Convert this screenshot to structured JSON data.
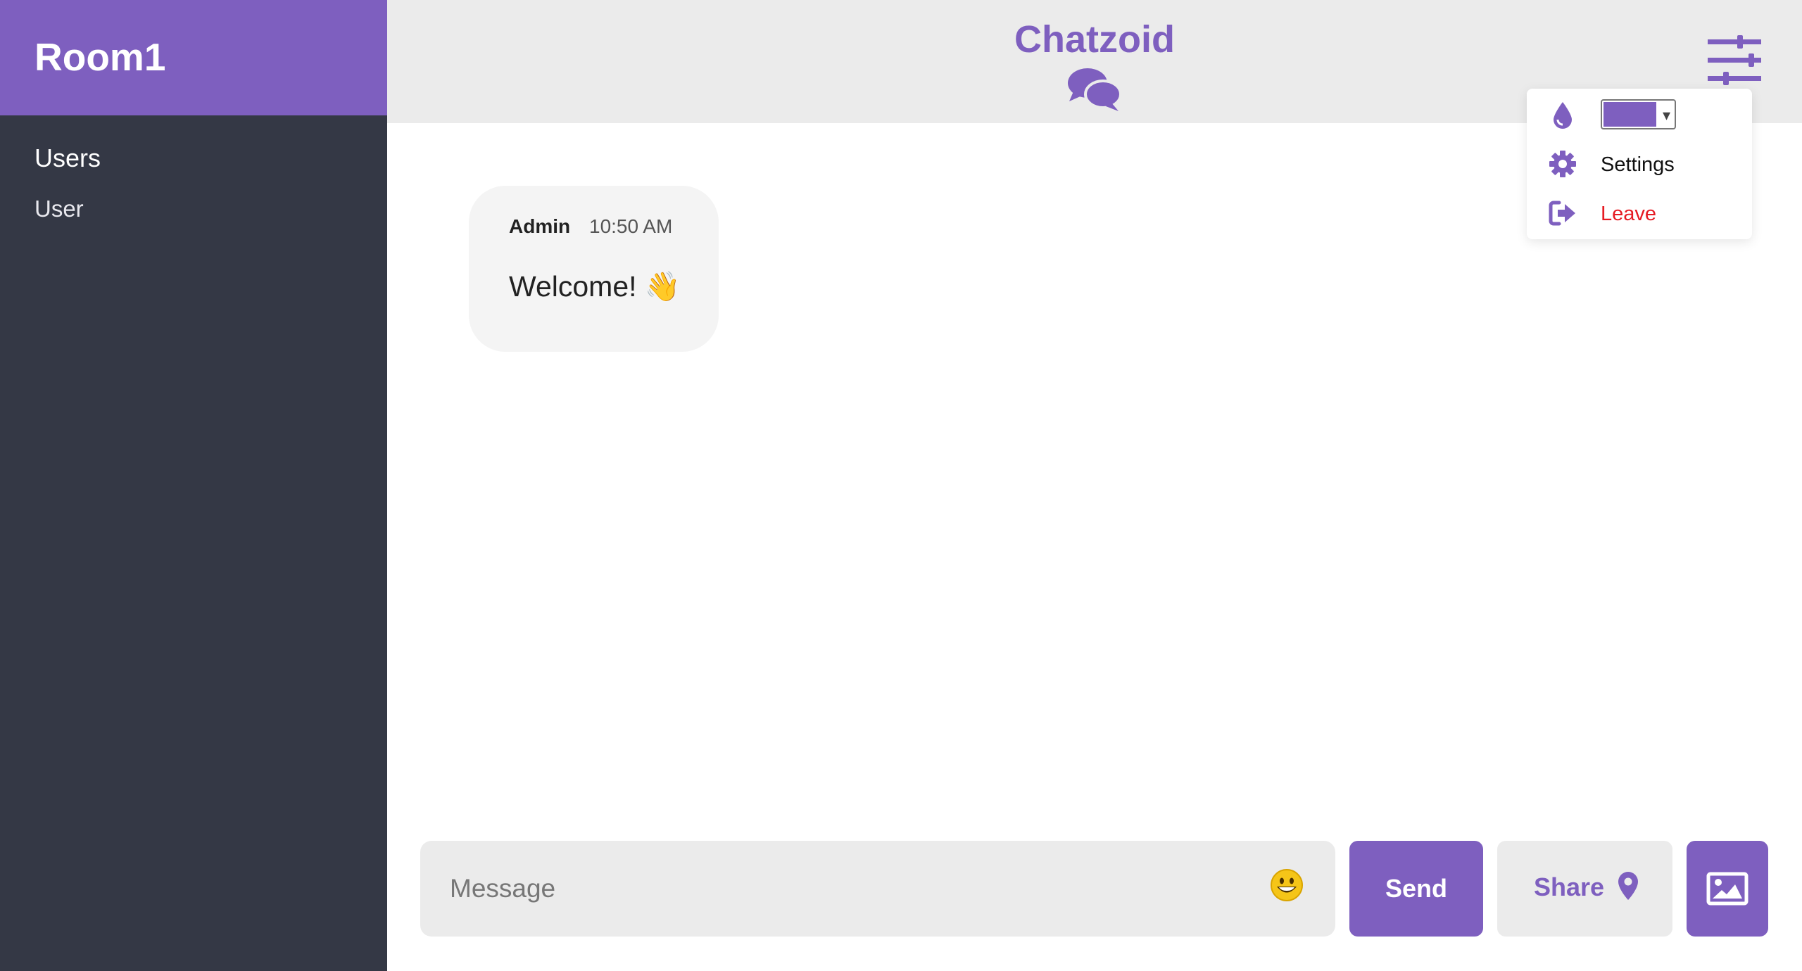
{
  "colors": {
    "accent": "#7e5fbf",
    "sidebar_bg": "#343845",
    "topbar_bg": "#ebebeb",
    "leave_red": "#e61b23"
  },
  "sidebar": {
    "room_name": "Room1",
    "users_heading": "Users",
    "users": [
      "User"
    ]
  },
  "header": {
    "title": "Chatzoid",
    "logo_icon": "chat-bubbles-icon",
    "menu_icon": "sliders-icon"
  },
  "menu": {
    "theme_icon": "droplet-icon",
    "theme_color_selected": "#7e5fbf",
    "settings_label": "Settings",
    "settings_icon": "gear-icon",
    "leave_label": "Leave",
    "leave_icon": "sign-out-icon"
  },
  "messages": [
    {
      "author": "Admin",
      "time": "10:50 AM",
      "text": "Welcome! 👋"
    }
  ],
  "composer": {
    "placeholder": "Message",
    "emoji_icon": "smiley-emoji-icon",
    "send_label": "Send",
    "share_label": "Share",
    "share_icon": "map-pin-icon",
    "image_icon": "image-icon"
  }
}
